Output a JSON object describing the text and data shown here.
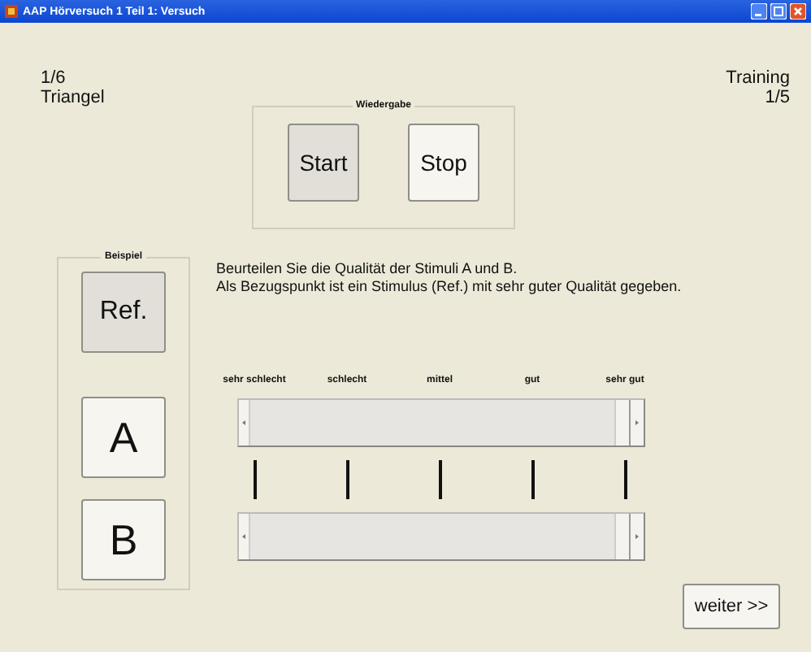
{
  "window": {
    "title": "AAP Hörversuch 1 Teil 1: Versuch"
  },
  "progress": {
    "item": "1/6",
    "name": "Triangel"
  },
  "mode": {
    "label": "Training",
    "count": "1/5"
  },
  "playback": {
    "title": "Wiedergabe",
    "buttons": [
      {
        "label": "Start",
        "pressed": true
      },
      {
        "label": "Stop",
        "pressed": false
      }
    ]
  },
  "example": {
    "title": "Beispiel",
    "buttons": [
      {
        "label": "Ref.",
        "pressed": true
      },
      {
        "label": "A",
        "pressed": false
      },
      {
        "label": "B",
        "pressed": false
      }
    ]
  },
  "instructions": [
    "Beurteilen Sie die Qualität der Stimuli A und B.",
    "Als Bezugspunkt ist ein Stimulus (Ref.) mit sehr guter Qualität gegeben."
  ],
  "scale": [
    "sehr schlecht",
    "schlecht",
    "mittel",
    "gut",
    "sehr gut"
  ],
  "sliders": [
    {
      "level": 1
    },
    {
      "level": 1
    }
  ],
  "next_button": "weiter >>"
}
